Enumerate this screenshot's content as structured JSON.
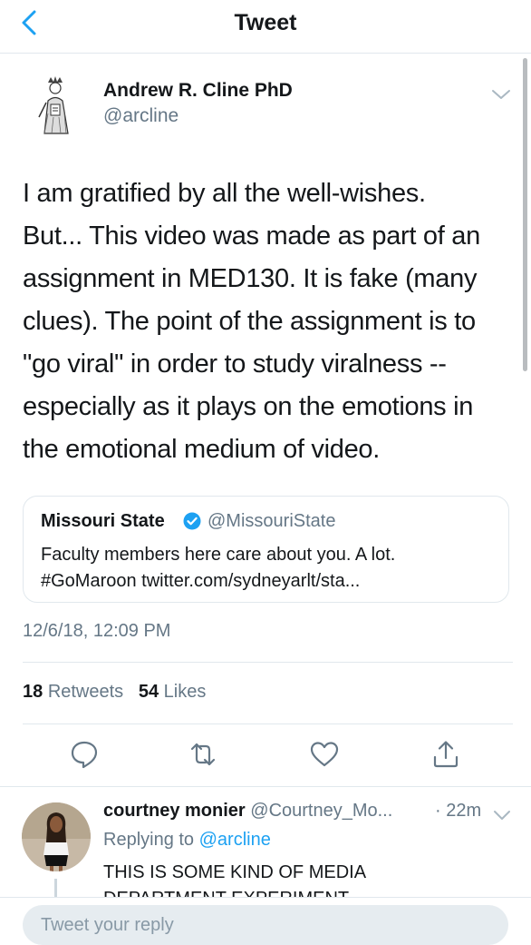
{
  "nav": {
    "title": "Tweet"
  },
  "tweet": {
    "author_name": "Andrew R. Cline PhD",
    "author_handle": "@arcline",
    "text_lines": [
      "I am gratified by all the well-wishes.",
      "But... This video was made as part of an",
      "assignment in MED130. It is fake (many",
      "clues). The point of the assignment is to",
      "\"go viral\" in order to study viralness --",
      "especially as it plays on the emotions in",
      "the emotional medium of video."
    ],
    "quote": {
      "name": "Missouri State",
      "handle": "@MissouriState",
      "line1": "Faculty members here care about you. A lot.",
      "line2": "#GoMaroon twitter.com/sydneyarlt/sta..."
    },
    "timestamp": "12/6/18, 12:09 PM",
    "retweets_count": "18",
    "retweets_label": "Retweets",
    "likes_count": "54",
    "likes_label": "Likes"
  },
  "reply": {
    "name": "courtney monier",
    "handle": "@Courtney_Mo...",
    "time": "· 22m",
    "replying_prefix": "Replying to",
    "replying_to": "@arcline",
    "text_line1": "THIS IS SOME KIND OF MEDIA",
    "text_line2": "DEPARTMENT EXPERIMENT"
  },
  "compose": {
    "placeholder": "Tweet your reply"
  },
  "icons": {
    "back": "chevron-left-icon",
    "menu": "chevron-down-icon",
    "verified": "verified-badge-icon",
    "reply": "reply-icon",
    "retweet": "retweet-icon",
    "like": "heart-icon",
    "share": "share-icon"
  },
  "colors": {
    "accent": "#1da1f2",
    "secondary_text": "#657786",
    "primary_text": "#14171a",
    "divider": "#e1e8ed"
  }
}
